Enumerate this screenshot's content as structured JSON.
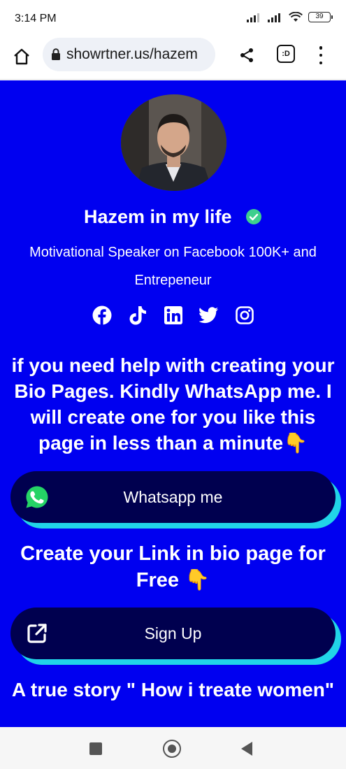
{
  "status_bar": {
    "time": "3:14 PM",
    "battery": "39"
  },
  "browser": {
    "url": "showrtner.us/hazem",
    "tabs_label": ":D"
  },
  "profile": {
    "name": "Hazem in my life",
    "bio": "Motivational Speaker on Facebook 100K+ and Entrepeneur",
    "social_icons": [
      "facebook-icon",
      "tiktok-icon",
      "linkedin-icon",
      "twitter-icon",
      "instagram-icon"
    ]
  },
  "content": {
    "promo_text": "if you need help with creating your Bio Pages. Kindly WhatsApp me. I will create one for you like this page in less than a minute👇",
    "whatsapp_button": "Whatsapp me",
    "heading_free": "Create your Link in bio page for Free 👇",
    "signup_button": "Sign Up",
    "heading_story": "A true story \" How i treate women\""
  },
  "colors": {
    "page_background": "#0000f0",
    "button_background": "#00004f",
    "button_shadow": "#21d4e8",
    "verified_badge": "#3ecf8e",
    "whatsapp_green": "#25d366"
  }
}
